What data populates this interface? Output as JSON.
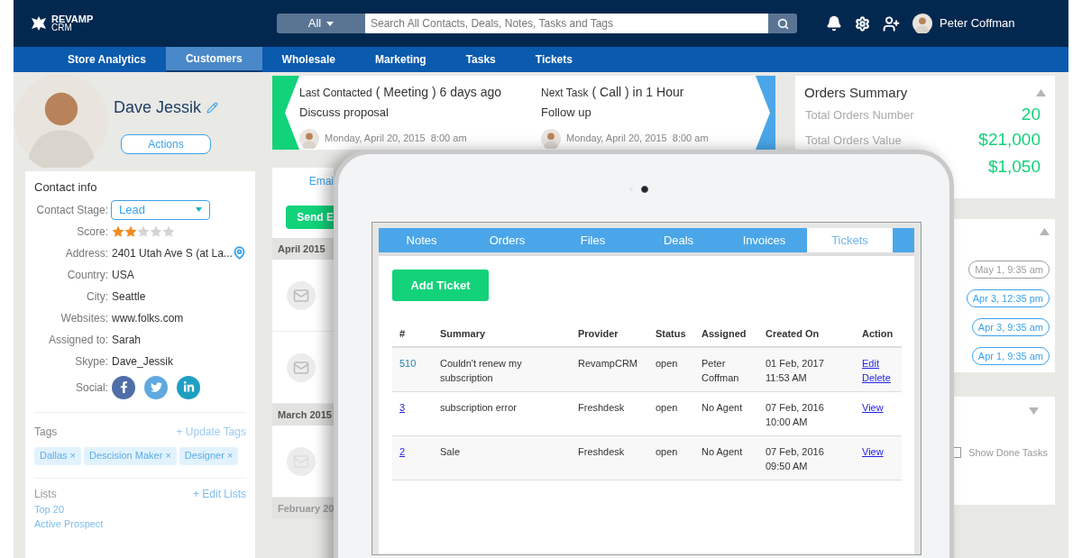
{
  "header": {
    "logo": "REVAMP",
    "logo_sub": "CRM",
    "search_scope": "All",
    "search_placeholder": "Search All Contacts, Deals, Notes, Tasks and Tags",
    "user_name": "Peter Coffman"
  },
  "nav": [
    {
      "label": "Store Analytics",
      "selected": false
    },
    {
      "label": "Customers",
      "selected": true
    },
    {
      "label": "Wholesale",
      "selected": false
    },
    {
      "label": "Marketing",
      "selected": false
    },
    {
      "label": "Tasks",
      "selected": false
    },
    {
      "label": "Tickets",
      "selected": false
    }
  ],
  "contact": {
    "name": "Dave Jessik",
    "actions": "Actions"
  },
  "contact_info": {
    "title": "Contact info",
    "stage_label": "Contact Stage:",
    "stage": "Lead",
    "score_label": "Score:",
    "stars": 2,
    "fields": [
      {
        "label": "Address:",
        "value": "2401 Utah Ave S (at La...",
        "kind": "location"
      },
      {
        "label": "Country:",
        "value": "USA",
        "kind": "text"
      },
      {
        "label": "City:",
        "value": "Seattle",
        "kind": "text"
      },
      {
        "label": "Websites:",
        "value": "www.folks.com",
        "kind": "text"
      },
      {
        "label": "Assigned to:",
        "value": "Sarah",
        "kind": "text"
      },
      {
        "label": "Skype:",
        "value": "Dave_Jessik",
        "kind": "text"
      }
    ],
    "social_label": "Social:"
  },
  "tags": {
    "title": "Tags",
    "action": "+ Update Tags",
    "remove_mark": "×",
    "items": [
      "Dallas",
      "Descision Maker",
      "Designer"
    ]
  },
  "lists": {
    "title": "Lists",
    "action": "+ Edit Lists",
    "items": [
      "Top 20",
      "Active Prospect"
    ]
  },
  "last_contacted": {
    "label": "Last Contacted",
    "detail": "( Meeting ) 6 days ago",
    "subject": "Discuss proposal",
    "date": "Monday, April 20, 2015  8:00 am"
  },
  "next_task": {
    "label": "Next Task",
    "detail": "( Call ) in 1 Hour",
    "subject": "Follow up",
    "date": "Monday, April 20, 2015  8:00 am"
  },
  "email_panel": {
    "link": "Emai",
    "button": "Send E"
  },
  "timeline": [
    {
      "month": "April 2015",
      "items": [
        {
          "kind": "email"
        },
        {
          "kind": "email"
        }
      ]
    },
    {
      "month": "March 2015",
      "items": [
        {
          "kind": "email"
        }
      ]
    },
    {
      "month": "February 20"
    }
  ],
  "orders_summary": {
    "title": "Orders Summary",
    "rows": [
      {
        "label": "Total Orders Number",
        "value": "20"
      },
      {
        "label": "Total Orders Value",
        "value": "$21,000"
      },
      {
        "value": "$1,050"
      }
    ]
  },
  "tasks": {
    "dates": [
      {
        "label": "May 1, 9:35 am",
        "color": "#9e9e9e"
      },
      {
        "label": "Apr 3, 12:35 pm",
        "color": "#3ba2ea"
      },
      {
        "label": "Apr 3, 9:35 am",
        "color": "#3ba2ea"
      },
      {
        "label": "Apr 1, 9:35 am",
        "color": "#3ba2ea"
      }
    ],
    "show_done": "Show Done Tasks",
    "show_done_checked": false
  },
  "tablet": {
    "tabs": [
      {
        "label": "Notes",
        "selected": false
      },
      {
        "label": "Orders",
        "selected": false
      },
      {
        "label": "Files",
        "selected": false
      },
      {
        "label": "Deals",
        "selected": false
      },
      {
        "label": "Invoices",
        "selected": false
      },
      {
        "label": "Tickets",
        "selected": true
      }
    ],
    "add_button": "Add Ticket",
    "columns": [
      "#",
      "Summary",
      "Provider",
      "Status",
      "Assigned",
      "Created On",
      "Action"
    ],
    "rows": [
      {
        "id": "510",
        "link": false,
        "summary": "Couldn't renew my subscription",
        "provider": "RevampCRM",
        "status": "open",
        "assigned": "Peter Coffman",
        "created": "01 Feb, 2017 11:53 AM",
        "actions": [
          "Edit",
          "Delete"
        ]
      },
      {
        "id": "3",
        "link": true,
        "summary": "subscription error",
        "provider": "Freshdesk",
        "status": "open",
        "assigned": "No Agent",
        "created": "07 Feb, 2016 10:00 AM",
        "actions": [
          "View"
        ]
      },
      {
        "id": "2",
        "link": true,
        "summary": "Sale",
        "provider": "Freshdesk",
        "status": "open",
        "assigned": "No Agent",
        "created": "07 Feb, 2016 09:50 AM",
        "actions": [
          "View"
        ]
      }
    ]
  }
}
